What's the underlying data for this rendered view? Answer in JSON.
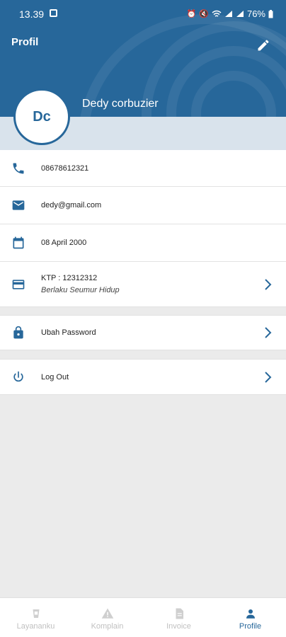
{
  "status_bar": {
    "time": "13.39",
    "battery": "76%"
  },
  "header": {
    "title": "Profil"
  },
  "profile": {
    "initials": "Dc",
    "name": "Dedy corbuzier"
  },
  "info": [
    {
      "icon": "phone-icon",
      "text": "08678612321"
    },
    {
      "icon": "email-icon",
      "text": "dedy@gmail.com"
    },
    {
      "icon": "calendar-icon",
      "text": "08 April 2000"
    },
    {
      "icon": "id-card-icon",
      "text": "KTP : 12312312",
      "subtext": "Berlaku Seumur Hidup"
    }
  ],
  "actions": [
    {
      "icon": "lock-icon",
      "label": "Ubah Password"
    },
    {
      "icon": "power-icon",
      "label": "Log Out"
    }
  ],
  "nav": [
    {
      "icon": "layananku-icon",
      "label": "Layananku",
      "active": false
    },
    {
      "icon": "warning-icon",
      "label": "Komplain",
      "active": false
    },
    {
      "icon": "invoice-icon",
      "label": "Invoice",
      "active": false
    },
    {
      "icon": "person-icon",
      "label": "Profile",
      "active": true
    }
  ],
  "colors": {
    "primary": "#27679a",
    "background": "#ebebeb"
  }
}
